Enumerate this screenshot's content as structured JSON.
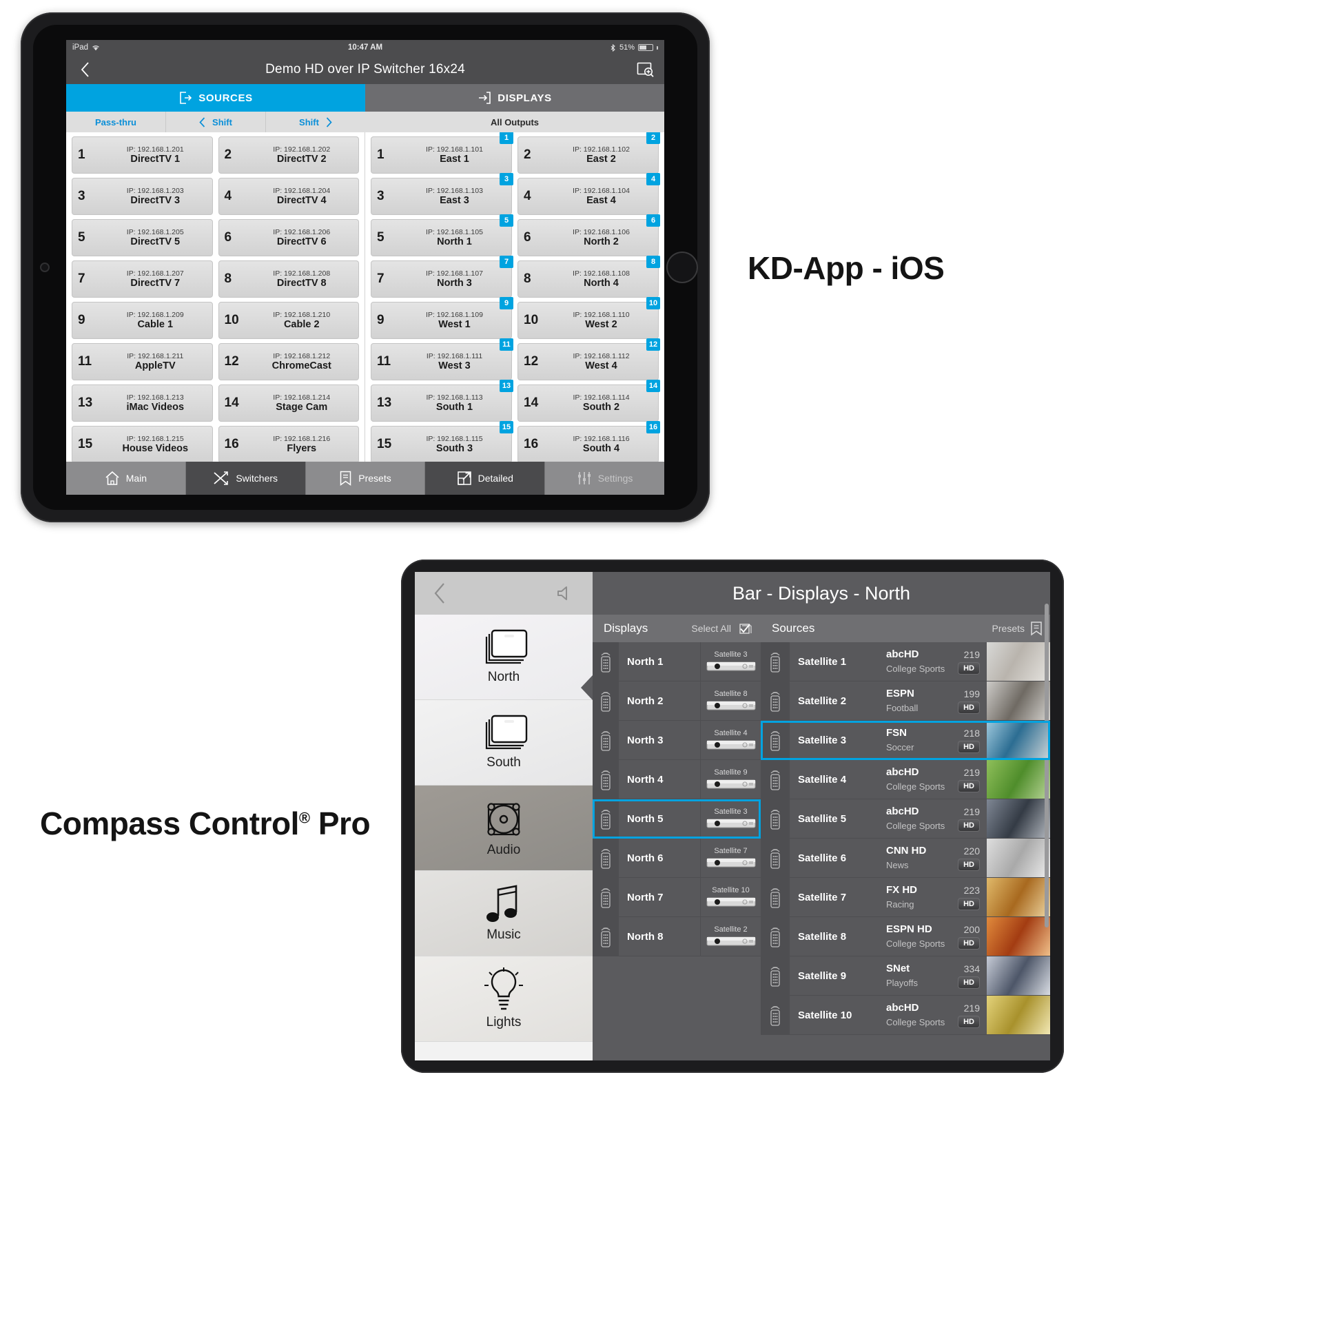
{
  "labels": {
    "kd_app": "KD-App - iOS",
    "compass": "Compass Control",
    "compass_sup": "®",
    "compass_tail": " Pro"
  },
  "ipad_ios": {
    "status_bar": {
      "device": "iPad",
      "wifi_icon": "wifi-icon",
      "time": "10:47 AM",
      "battery_percent": "51%",
      "battery_icon": "battery-icon"
    },
    "nav": {
      "back_icon": "chevron-left-icon",
      "title": "Demo HD over IP Switcher 16x24",
      "right_icon": "scan-zoom-icon"
    },
    "segments": [
      {
        "label": "SOURCES",
        "icon": "export-icon",
        "active": true
      },
      {
        "label": "DISPLAYS",
        "icon": "import-icon",
        "active": false
      }
    ],
    "sources_subbar": [
      {
        "label": "Pass-thru",
        "icon": ""
      },
      {
        "label": "Shift",
        "icon": "chevron-left-icon"
      },
      {
        "label": "Shift",
        "icon": "chevron-right-icon"
      }
    ],
    "displays_subbar": {
      "label": "All Outputs"
    },
    "sources": [
      {
        "num": "1",
        "ip": "IP: 192.168.1.201",
        "name": "DirectTV 1"
      },
      {
        "num": "2",
        "ip": "IP: 192.168.1.202",
        "name": "DirectTV 2"
      },
      {
        "num": "3",
        "ip": "IP: 192.168.1.203",
        "name": "DirectTV 3"
      },
      {
        "num": "4",
        "ip": "IP: 192.168.1.204",
        "name": "DirectTV 4"
      },
      {
        "num": "5",
        "ip": "IP: 192.168.1.205",
        "name": "DirectTV 5"
      },
      {
        "num": "6",
        "ip": "IP: 192.168.1.206",
        "name": "DirectTV 6"
      },
      {
        "num": "7",
        "ip": "IP: 192.168.1.207",
        "name": "DirectTV 7"
      },
      {
        "num": "8",
        "ip": "IP: 192.168.1.208",
        "name": "DirectTV 8"
      },
      {
        "num": "9",
        "ip": "IP: 192.168.1.209",
        "name": "Cable 1"
      },
      {
        "num": "10",
        "ip": "IP: 192.168.1.210",
        "name": "Cable 2"
      },
      {
        "num": "11",
        "ip": "IP: 192.168.1.211",
        "name": "AppleTV"
      },
      {
        "num": "12",
        "ip": "IP: 192.168.1.212",
        "name": "ChromeCast"
      },
      {
        "num": "13",
        "ip": "IP: 192.168.1.213",
        "name": "iMac Videos"
      },
      {
        "num": "14",
        "ip": "IP: 192.168.1.214",
        "name": "Stage Cam"
      },
      {
        "num": "15",
        "ip": "IP: 192.168.1.215",
        "name": "House Videos"
      },
      {
        "num": "16",
        "ip": "IP: 192.168.1.216",
        "name": "Flyers"
      }
    ],
    "displays": [
      {
        "num": "1",
        "ip": "IP: 192.168.1.101",
        "name": "East 1",
        "badge": "1"
      },
      {
        "num": "2",
        "ip": "IP: 192.168.1.102",
        "name": "East 2",
        "badge": "2"
      },
      {
        "num": "3",
        "ip": "IP: 192.168.1.103",
        "name": "East 3",
        "badge": "3"
      },
      {
        "num": "4",
        "ip": "IP: 192.168.1.104",
        "name": "East 4",
        "badge": "4"
      },
      {
        "num": "5",
        "ip": "IP: 192.168.1.105",
        "name": "North 1",
        "badge": "5"
      },
      {
        "num": "6",
        "ip": "IP: 192.168.1.106",
        "name": "North 2",
        "badge": "6"
      },
      {
        "num": "7",
        "ip": "IP: 192.168.1.107",
        "name": "North 3",
        "badge": "7"
      },
      {
        "num": "8",
        "ip": "IP: 192.168.1.108",
        "name": "North 4",
        "badge": "8"
      },
      {
        "num": "9",
        "ip": "IP: 192.168.1.109",
        "name": "West 1",
        "badge": "9"
      },
      {
        "num": "10",
        "ip": "IP: 192.168.1.110",
        "name": "West 2",
        "badge": "10"
      },
      {
        "num": "11",
        "ip": "IP: 192.168.1.111",
        "name": "West 3",
        "badge": "11"
      },
      {
        "num": "12",
        "ip": "IP: 192.168.1.112",
        "name": "West 4",
        "badge": "12"
      },
      {
        "num": "13",
        "ip": "IP: 192.168.1.113",
        "name": "South 1",
        "badge": "13"
      },
      {
        "num": "14",
        "ip": "IP: 192.168.1.114",
        "name": "South 2",
        "badge": "14"
      },
      {
        "num": "15",
        "ip": "IP: 192.168.1.115",
        "name": "South 3",
        "badge": "15"
      },
      {
        "num": "16",
        "ip": "IP: 192.168.1.116",
        "name": "South 4",
        "badge": "16"
      }
    ],
    "tabs": [
      {
        "label": "Main",
        "icon": "home-icon",
        "state": "light"
      },
      {
        "label": "Switchers",
        "icon": "shuffle-icon",
        "state": "dark"
      },
      {
        "label": "Presets",
        "icon": "bookmark-icon",
        "state": "light"
      },
      {
        "label": "Detailed",
        "icon": "expand-icon",
        "state": "dark"
      },
      {
        "label": "Settings",
        "icon": "sliders-icon",
        "state": "dim"
      }
    ]
  },
  "compass": {
    "topbar": {
      "back_icon": "chevron-left-icon",
      "volume_icon": "speaker-icon"
    },
    "nav_items": [
      {
        "label": "North",
        "icon": "displays-stack-icon"
      },
      {
        "label": "South",
        "icon": "displays-stack-icon"
      },
      {
        "label": "Audio",
        "icon": "speaker-driver-icon"
      },
      {
        "label": "Music",
        "icon": "music-note-icon"
      },
      {
        "label": "Lights",
        "icon": "lightbulb-icon"
      }
    ],
    "title": "Bar - Displays - North",
    "displays_header": {
      "label": "Displays",
      "action": "Select All",
      "action_icon": "select-all-icon"
    },
    "sources_header": {
      "label": "Sources",
      "action": "Presets",
      "action_icon": "bookmark-icon"
    },
    "displays": [
      {
        "name": "North 1",
        "source": "Satellite 3",
        "selected": false
      },
      {
        "name": "North 2",
        "source": "Satellite 8",
        "selected": false
      },
      {
        "name": "North 3",
        "source": "Satellite 4",
        "selected": false
      },
      {
        "name": "North 4",
        "source": "Satellite 9",
        "selected": false
      },
      {
        "name": "North 5",
        "source": "Satellite 3",
        "selected": true
      },
      {
        "name": "North 6",
        "source": "Satellite 7",
        "selected": false
      },
      {
        "name": "North 7",
        "source": "Satellite 10",
        "selected": false
      },
      {
        "name": "North 8",
        "source": "Satellite 2",
        "selected": false
      }
    ],
    "sources": [
      {
        "name": "Satellite 1",
        "channel": "abcHD",
        "number": "219",
        "genre": "College Sports",
        "quality": "HD",
        "selected": false
      },
      {
        "name": "Satellite 2",
        "channel": "ESPN",
        "number": "199",
        "genre": "Football",
        "quality": "HD",
        "selected": false
      },
      {
        "name": "Satellite 3",
        "channel": "FSN",
        "number": "218",
        "genre": "Soccer",
        "quality": "HD",
        "selected": true
      },
      {
        "name": "Satellite 4",
        "channel": "abcHD",
        "number": "219",
        "genre": "College Sports",
        "quality": "HD",
        "selected": false
      },
      {
        "name": "Satellite 5",
        "channel": "abcHD",
        "number": "219",
        "genre": "College Sports",
        "quality": "HD",
        "selected": false
      },
      {
        "name": "Satellite 6",
        "channel": "CNN HD",
        "number": "220",
        "genre": "News",
        "quality": "HD",
        "selected": false
      },
      {
        "name": "Satellite 7",
        "channel": "FX HD",
        "number": "223",
        "genre": "Racing",
        "quality": "HD",
        "selected": false
      },
      {
        "name": "Satellite 8",
        "channel": "ESPN HD",
        "number": "200",
        "genre": "College Sports",
        "quality": "HD",
        "selected": false
      },
      {
        "name": "Satellite 9",
        "channel": "SNet",
        "number": "334",
        "genre": "Playoffs",
        "quality": "HD",
        "selected": false
      },
      {
        "name": "Satellite 10",
        "channel": "abcHD",
        "number": "219",
        "genre": "College Sports",
        "quality": "HD",
        "selected": false
      }
    ]
  },
  "colors": {
    "accent": "#00a3e0",
    "nav_gray": "#4c4c4e",
    "panel_gray": "#5b5b5e",
    "card_gray": "#dadada"
  }
}
